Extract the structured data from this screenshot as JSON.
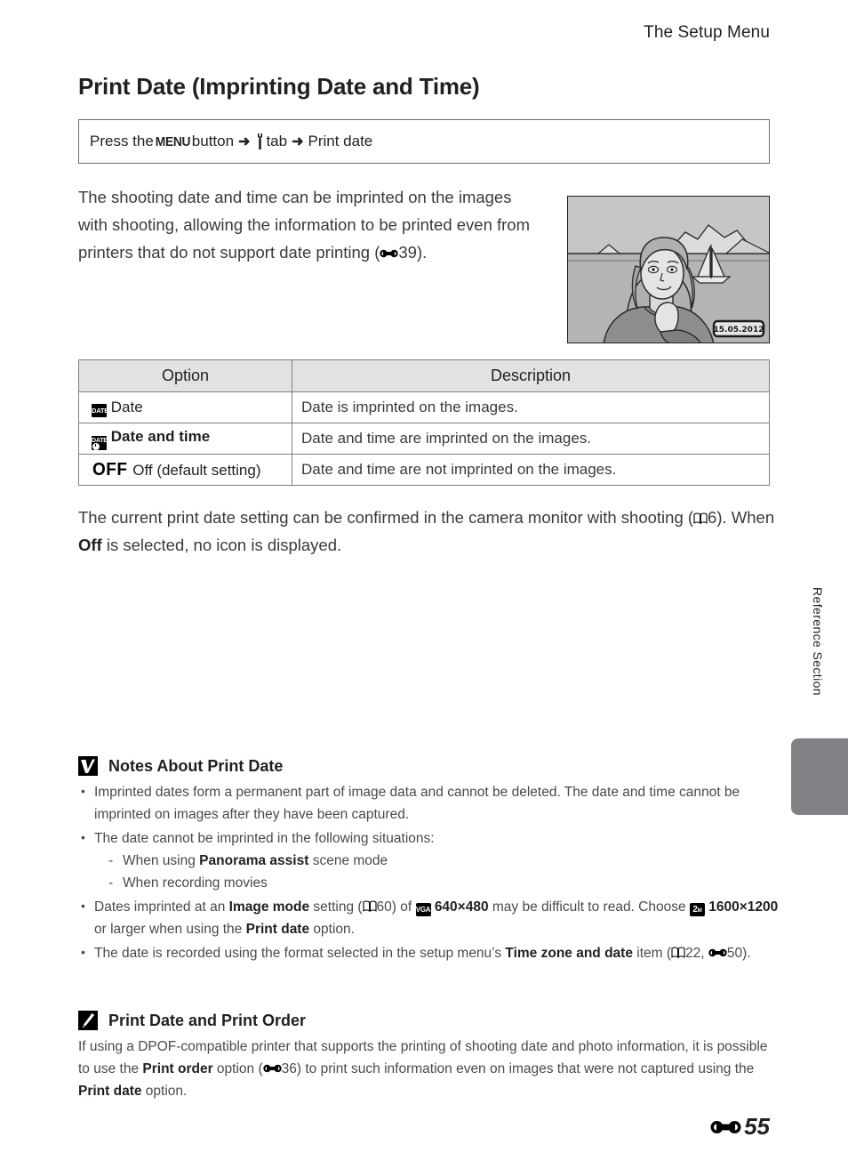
{
  "running_head": "The Setup Menu",
  "page_title": "Print Date (Imprinting Date and Time)",
  "menu_path": {
    "prefix": "Press the ",
    "menu_button": "MENU",
    "button_word": " button ",
    "tab_word": " tab ",
    "destination": "Print date",
    "wrench_icon": "wrench-icon",
    "arrow_icon": "arrow-right-icon"
  },
  "intro": {
    "text_before_ref": "The shooting date and time can be imprinted on the images with shooting, allowing the information to be printed even from printers that do not support date printing (",
    "ref_icon": "reference-section-icon",
    "ref_number": "39",
    "text_after_ref": ")."
  },
  "illustration": {
    "name": "camera-monitor-illustration",
    "date_stamp": "15.05.2012"
  },
  "table": {
    "headers": [
      "Option",
      "Description"
    ],
    "rows": [
      {
        "icon": "date-icon",
        "icon_text": "DATE",
        "option": "Date",
        "description": "Date is imprinted on the images."
      },
      {
        "icon": "date-and-time-icon",
        "icon_text": "DATE",
        "option": "Date and time",
        "description": "Date and time are imprinted on the images."
      },
      {
        "icon": "off-icon",
        "icon_text": "OFF",
        "option": "Off (default setting)",
        "description": "Date and time are not imprinted on the images."
      }
    ]
  },
  "confirm_paragraph": {
    "part1": "The current print date setting can be confirmed in the camera monitor with shooting (",
    "book_icon": "manual-book-icon",
    "ref1": "6",
    "part2": "). When ",
    "bold1": "Off",
    "part3": " is selected, no icon is displayed."
  },
  "side_label": "Reference Section",
  "notes": {
    "icon": "checkmark-note-icon",
    "title": "Notes About Print Date",
    "bullets": [
      {
        "text": "Imprinted dates form a permanent part of image data and cannot be deleted. The date and time cannot be imprinted on images after they have been captured."
      },
      {
        "text": "The date cannot be imprinted in the following situations:",
        "sub": [
          {
            "pre": "When using ",
            "bold": "Panorama assist",
            "post": " scene mode"
          },
          {
            "pre": "When recording movies",
            "bold": "",
            "post": ""
          }
        ]
      },
      {
        "rich": [
          {
            "t": "Dates imprinted at an "
          },
          {
            "t": "Image mode",
            "b": true
          },
          {
            "t": " setting ("
          },
          {
            "icon": "manual-book-icon"
          },
          {
            "t": "60) of "
          },
          {
            "icon": "vga-icon",
            "icon_text": "VGA"
          },
          {
            "t": " "
          },
          {
            "t": "640×480",
            "b": true
          },
          {
            "t": " may be difficult to read. Choose "
          },
          {
            "icon": "two-megapixel-icon",
            "icon_text": "2M"
          },
          {
            "t": " "
          },
          {
            "t": "1600×1200",
            "b": true
          },
          {
            "t": " or larger when using the "
          },
          {
            "t": "Print date",
            "b": true
          },
          {
            "t": " option."
          }
        ]
      },
      {
        "rich": [
          {
            "t": "The date is recorded using the format selected in the setup menu’s "
          },
          {
            "t": "Time zone and date",
            "b": true
          },
          {
            "t": " item ("
          },
          {
            "icon": "manual-book-icon"
          },
          {
            "t": "22, "
          },
          {
            "icon": "reference-section-icon"
          },
          {
            "t": "50)."
          }
        ]
      }
    ]
  },
  "tip": {
    "icon": "pencil-note-icon",
    "title": "Print Date and Print Order",
    "rich": [
      {
        "t": "If using a DPOF-compatible printer that supports the printing of shooting date and photo information, it is possible to use the "
      },
      {
        "t": "Print order",
        "b": true
      },
      {
        "t": " option ("
      },
      {
        "icon": "reference-section-icon"
      },
      {
        "t": "36) to print such information even on images that were not captured using the "
      },
      {
        "t": "Print date",
        "b": true
      },
      {
        "t": " option."
      }
    ]
  },
  "footer": {
    "ref_icon": "reference-section-icon",
    "page_number": "55"
  },
  "colors": {
    "text": "#231f20",
    "body_text": "#3a3a3a",
    "table_header_bg": "#e2e2e2",
    "table_border": "#808080",
    "side_tab": "#808285"
  }
}
